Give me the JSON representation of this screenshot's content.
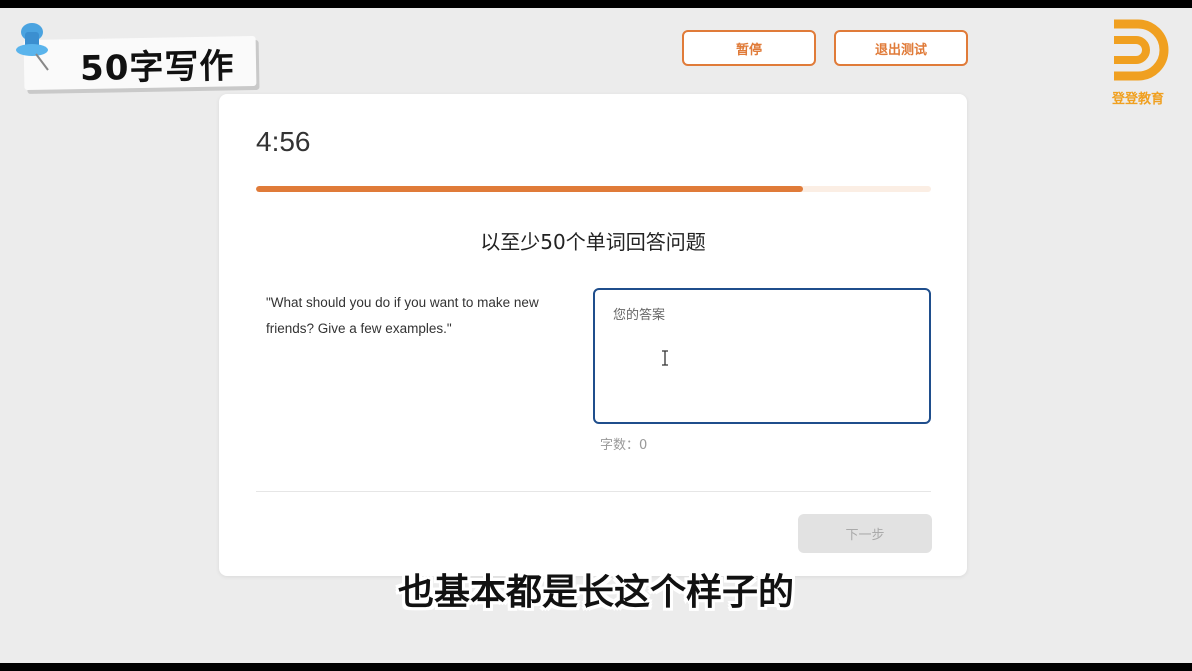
{
  "overlay": {
    "title_sticker": "50字写作",
    "caption": "也基本都是长这个样子的",
    "brand_name": "登登教育"
  },
  "toolbar": {
    "pause_label": "暂停",
    "exit_label": "退出测试"
  },
  "test": {
    "timer": "4:56",
    "progress_fraction": 0.81,
    "question_title": "以至少50个单词回答问题",
    "prompt": "\"What should you do if you want to make new friends? Give a few examples.\"",
    "answer_placeholder": "您的答案",
    "answer_value": "",
    "word_count": "字数：0",
    "next_label": "下一步"
  },
  "colors": {
    "accent": "#e07b39",
    "input_border": "#1f4e8c",
    "brand": "#f0a020"
  }
}
